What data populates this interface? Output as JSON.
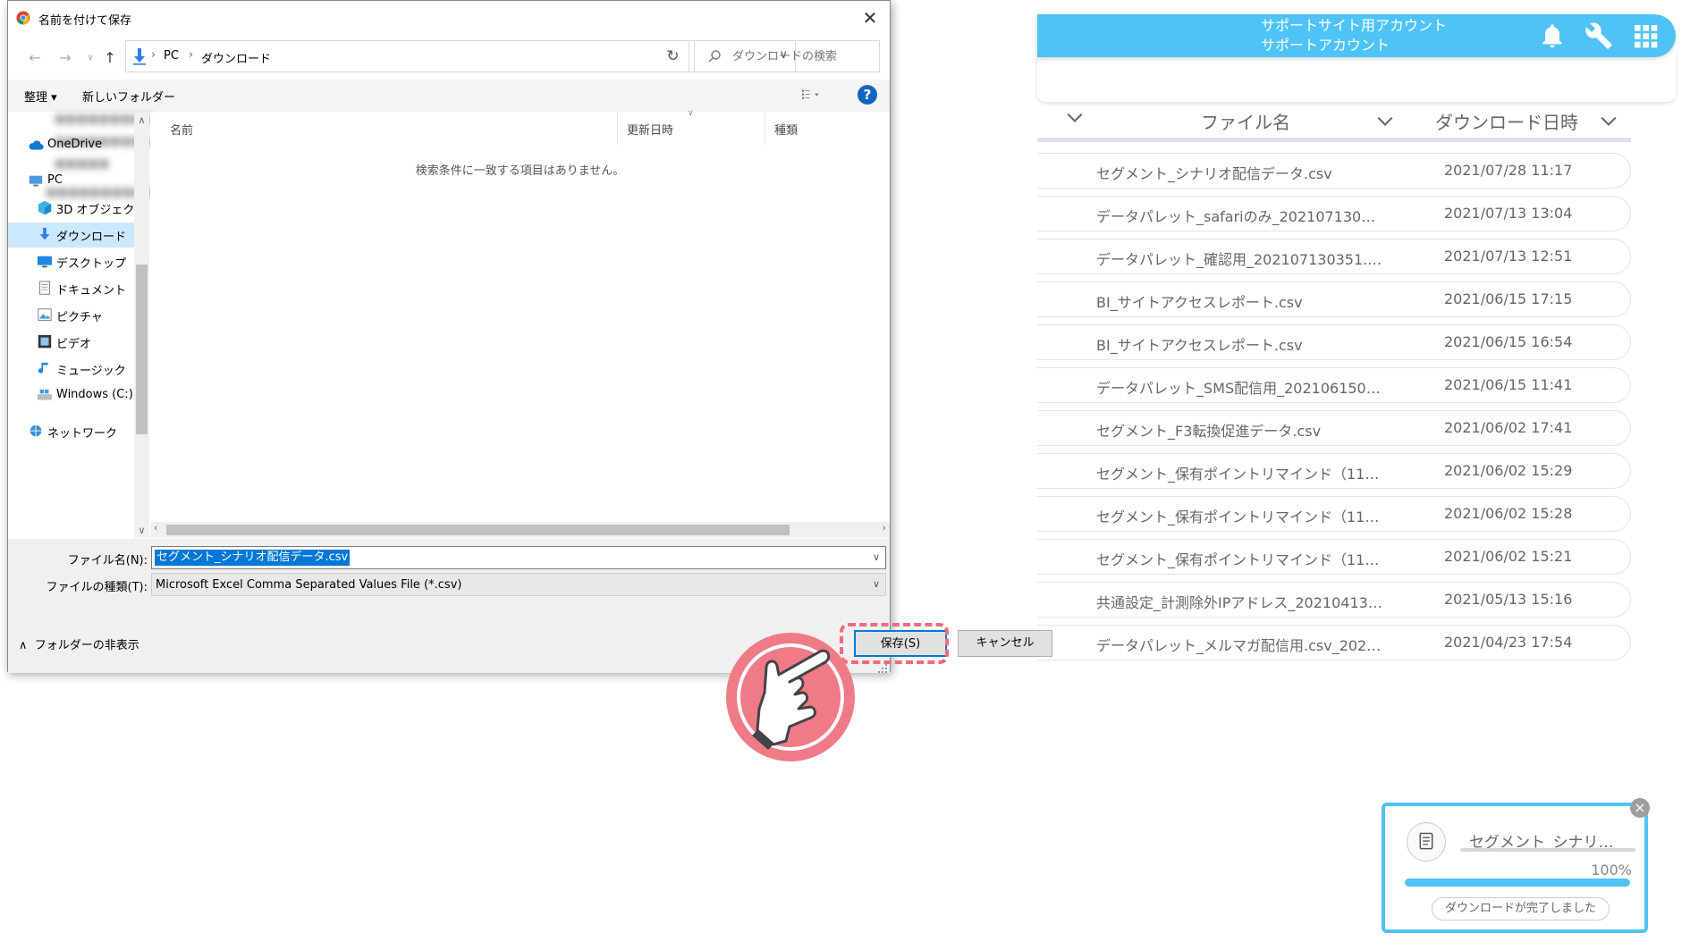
{
  "app": {
    "account_line1": "サポートサイト用アカウント",
    "account_line2": "サポートアカウント",
    "brand_color": "#4fc3f7",
    "icons": [
      "bell-icon",
      "wrench-icon",
      "grid-icon",
      "logout-icon"
    ],
    "columns": {
      "file_name": "ファイル名",
      "download_date": "ダウンロード日時"
    },
    "files": [
      {
        "name": "セグメント_シナリオ配信データ.csv",
        "date": "2021/07/28 11:17"
      },
      {
        "name": "データパレット_safariのみ_20210713040…",
        "date": "2021/07/13 13:04"
      },
      {
        "name": "データパレット_確認用_202107130351.csv",
        "date": "2021/07/13 12:51"
      },
      {
        "name": "BI_サイトアクセスレポート.csv",
        "date": "2021/06/15 17:15"
      },
      {
        "name": "BI_サイトアクセスレポート.csv",
        "date": "2021/06/15 16:54"
      },
      {
        "name": "データパレット_SMS配信用_20210615024…",
        "date": "2021/06/15 11:41"
      },
      {
        "name": "セグメント_F3転換促進データ.csv",
        "date": "2021/06/02 17:41"
      },
      {
        "name": "セグメント_保有ポイントリマインド（11~1…",
        "date": "2021/06/02 15:29"
      },
      {
        "name": "セグメント_保有ポイントリマインド（11~1…",
        "date": "2021/06/02 15:28"
      },
      {
        "name": "セグメント_保有ポイントリマインド（11~1…",
        "date": "2021/06/02 15:21"
      },
      {
        "name": "共通設定_計測除外IPアドレス_2021041315…",
        "date": "2021/05/13 15:16"
      },
      {
        "name": "データパレット_メルマガ配信用.csv_20210…",
        "date": "2021/04/23 17:54"
      }
    ],
    "toast": {
      "file_name": "セグメント_シナリ…",
      "percent": "100%",
      "progress": 1.0,
      "status": "ダウンロードが完了しました",
      "close": "×"
    }
  },
  "dialog": {
    "title": "名前を付けて保存",
    "close": "✕",
    "path": [
      "PC",
      "ダウンロード"
    ],
    "search_placeholder": "ダウンロードの検索",
    "organize": "整理 ▾",
    "new_folder": "新しいフォルダー",
    "nav_items": [
      {
        "label": "OneDrive",
        "icon": "cloud-icon"
      },
      {
        "label": "PC",
        "icon": "computer-icon"
      },
      {
        "label": "3D オブジェクト",
        "icon": "cube-icon"
      },
      {
        "label": "ダウンロード",
        "icon": "download-arrow-icon"
      },
      {
        "label": "デスクトップ",
        "icon": "desktop-icon"
      },
      {
        "label": "ドキュメント",
        "icon": "document-icon"
      },
      {
        "label": "ピクチャ",
        "icon": "picture-icon"
      },
      {
        "label": "ビデオ",
        "icon": "video-icon"
      },
      {
        "label": "ミュージック",
        "icon": "music-icon"
      },
      {
        "label": "Windows (C:)",
        "icon": "drive-icon"
      },
      {
        "label": "ネットワーク",
        "icon": "network-icon"
      }
    ],
    "columns": {
      "name": "名前",
      "modified": "更新日時",
      "type": "種類"
    },
    "empty_message": "検索条件に一致する項目はありません。",
    "filename_label": "ファイル名(N):",
    "filename_value": "セグメント_シナリオ配信データ.csv",
    "filetype_label": "ファイルの種類(T):",
    "filetype_value": "Microsoft Excel Comma Separated Values File (*.csv)",
    "hide_folders": "フォルダーの非表示",
    "save": "保存(S)",
    "cancel": "キャンセル"
  },
  "highlight_color": "#f06b7d"
}
